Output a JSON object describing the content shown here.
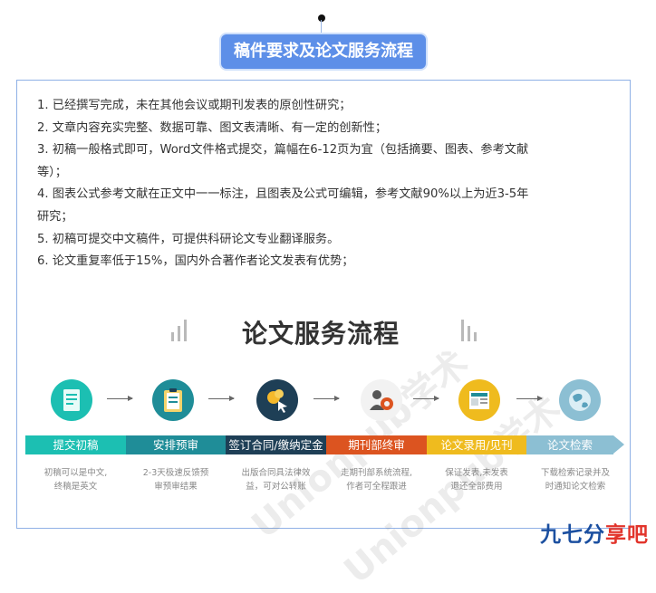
{
  "title": "稿件要求及论文服务流程",
  "requirements": [
    "1. 已经撰写完成，未在其他会议或期刊发表的原创性研究；",
    "2. 文章内容充实完整、数据可靠、图文表清晰、有一定的创新性；",
    "3. 初稿一般格式即可，Word文件格式提交，篇幅在6-12页为宜（包括摘要、图表、参考文献",
    "等）；",
    "4. 图表公式参考文献在正文中一一标注，且图表及公式可编辑，参考文献90%以上为近3-5年",
    "研究；",
    "5. 初稿可提交中文稿件，可提供科研论文专业翻译服务。",
    "6. 论文重复率低于15%，国内外合著作者论文发表有优势；"
  ],
  "flow": {
    "title": "论文服务流程",
    "watermark": "Unionpub学术",
    "steps": [
      {
        "label": "提交初稿",
        "desc1": "初稿可以是中文,",
        "desc2": "终稿是英文",
        "icon": "document-icon",
        "color": "#1cbfb2"
      },
      {
        "label": "安排预审",
        "desc1": "2-3天极速反馈预",
        "desc2": "审预审结果",
        "icon": "clipboard-icon",
        "color": "#1f8d98"
      },
      {
        "label": "签订合同/缴纳定金",
        "desc1": "出版合同具法律效",
        "desc2": "益，可对公转账",
        "icon": "coin-cursor-icon",
        "color": "#1e3f56"
      },
      {
        "label": "期刊部终审",
        "desc1": "走期刊部系统流程,",
        "desc2": "作者可全程跟进",
        "icon": "gear-person-icon",
        "color": "#dc5420"
      },
      {
        "label": "论文录用/见刊",
        "desc1": "保证发表,未发表",
        "desc2": "退还全部费用",
        "icon": "newspaper-icon",
        "color": "#efbb1e"
      },
      {
        "label": "论文检索",
        "desc1": "下载检索记录并及",
        "desc2": "时通知论文检索",
        "icon": "globe-icon",
        "color": "#8cbfd3"
      }
    ]
  },
  "brand": "九七分享吧",
  "colors": {
    "accent": "#5d8fe8",
    "frame": "#8fb0e6",
    "brand": "#1b4fa0"
  }
}
